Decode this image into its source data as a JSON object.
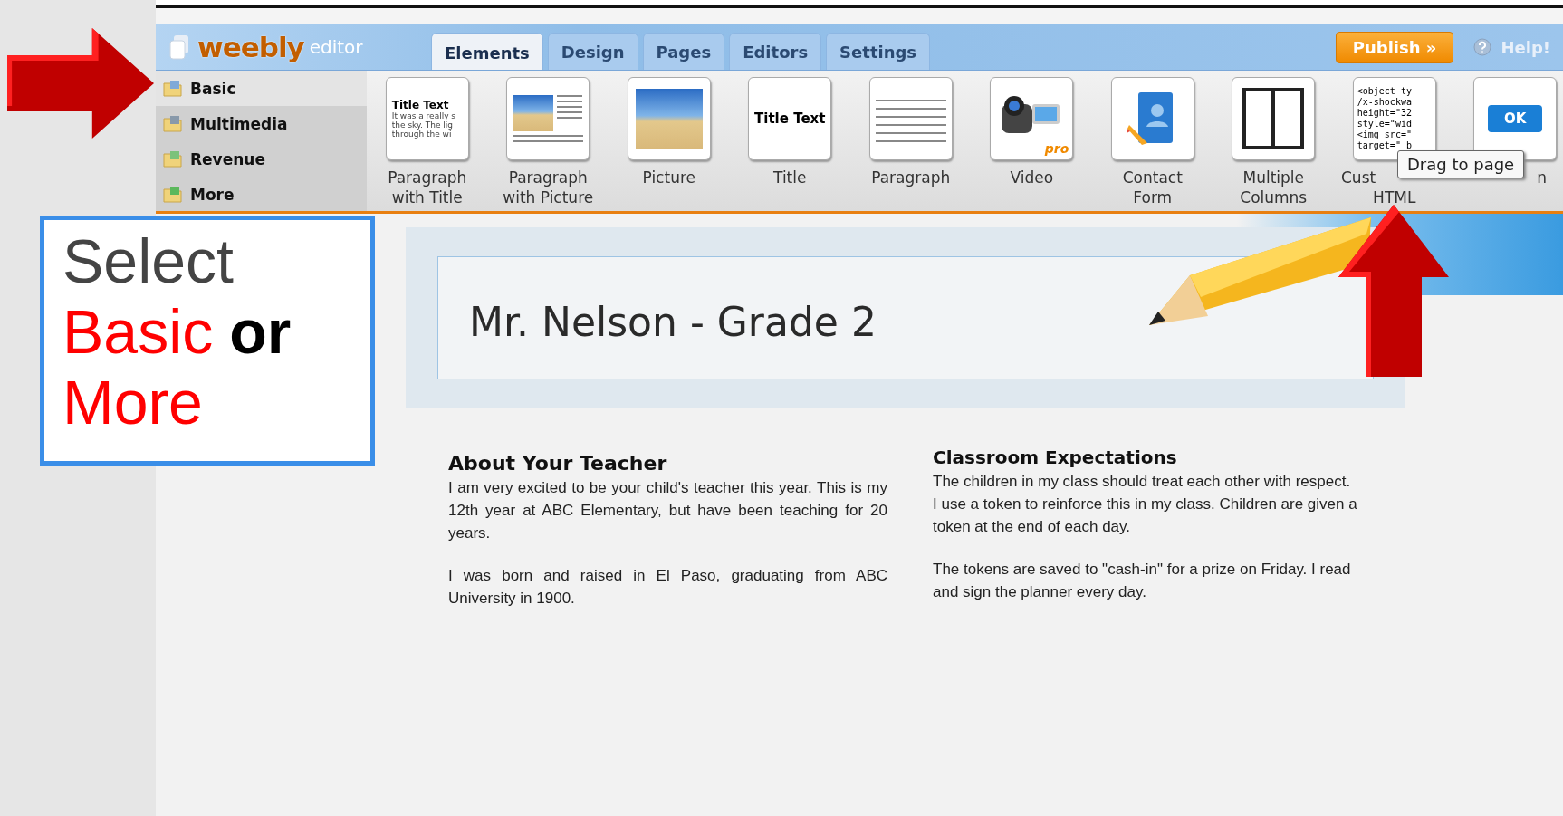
{
  "editor": {
    "logo": "weebly",
    "logo_suffix": "editor",
    "tabs": [
      {
        "label": "Elements",
        "selected": true
      },
      {
        "label": "Design",
        "selected": false
      },
      {
        "label": "Pages",
        "selected": false
      },
      {
        "label": "Editors",
        "selected": false
      },
      {
        "label": "Settings",
        "selected": false
      }
    ],
    "publish": "Publish »",
    "help": "Help!"
  },
  "categories": [
    {
      "label": "Basic",
      "selected": true,
      "kind": "basic"
    },
    {
      "label": "Multimedia",
      "selected": false,
      "kind": "media"
    },
    {
      "label": "Revenue",
      "selected": false,
      "kind": "revenue"
    },
    {
      "label": "More",
      "selected": false,
      "kind": "more"
    }
  ],
  "elements": [
    {
      "kind": "paragraph-title",
      "label": [
        "Paragraph",
        "with Title"
      ],
      "preview_title": "Title Text",
      "preview_lines": [
        "It was a really s",
        "the sky.  The lig",
        "through the wi"
      ]
    },
    {
      "kind": "paragraph-picture",
      "label": [
        "Paragraph",
        "with Picture"
      ]
    },
    {
      "kind": "picture",
      "label": [
        "Picture"
      ]
    },
    {
      "kind": "title",
      "label": [
        "Title"
      ],
      "preview_title": "Title Text"
    },
    {
      "kind": "paragraph",
      "label": [
        "Paragraph"
      ]
    },
    {
      "kind": "video",
      "label": [
        "Video"
      ],
      "badge": "pro"
    },
    {
      "kind": "contact",
      "label": [
        "Contact",
        "Form"
      ]
    },
    {
      "kind": "columns",
      "label": [
        "Multiple",
        "Columns"
      ]
    },
    {
      "kind": "code",
      "label": [
        "Cust",
        "HTML"
      ],
      "preview_lines": [
        "<object ty",
        "/x-shockwa",
        "height=\"32",
        "style=\"wid",
        "<img src=\"",
        "target=\"_b"
      ]
    },
    {
      "kind": "button",
      "label": [
        "n"
      ],
      "button_text": "OK"
    }
  ],
  "tooltip": "Drag to page",
  "callout": {
    "parts": [
      {
        "text": "Select",
        "kind": "plain"
      },
      {
        "text": "Basic",
        "kind": "highlight"
      },
      {
        "text": "or",
        "kind": "bold"
      },
      {
        "text": "More",
        "kind": "highlight"
      }
    ]
  },
  "site": {
    "title": "Mr. Nelson - Grade 2",
    "columns": [
      {
        "heading": "About Your Teacher",
        "paragraphs": [
          "I am very excited to be your child's teacher this year. This is my 12th year at ABC Elementary, but have been teaching for 20 years.",
          "I was born and raised in El Paso, graduating from ABC University in 1900."
        ]
      },
      {
        "heading": "Classroom Expectations",
        "paragraphs": [
          "The children in my class should treat each other with respect. I use a token to reinforce this in my class. Children are  given a token at the end of each day.",
          "The  tokens are saved to \"cash-in\" for a prize on Friday.  I read and sign the  planner every day."
        ]
      }
    ]
  }
}
